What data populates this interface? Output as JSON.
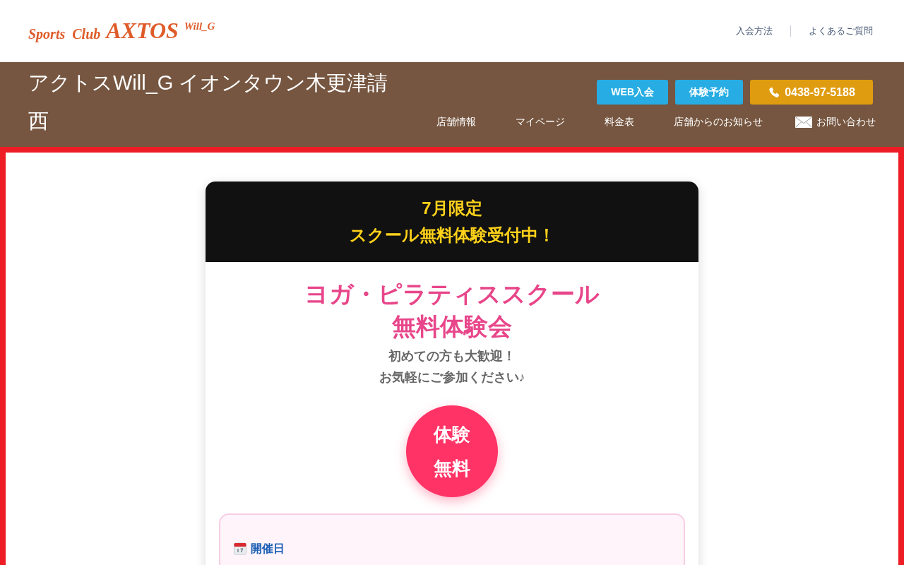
{
  "header": {
    "logo": {
      "prefix": "Sports  Club",
      "brand": "AXTOS",
      "suffix": "Will_G"
    },
    "links": [
      "入会方法",
      "よくあるご質問"
    ]
  },
  "store_bar": {
    "title": "アクトスWill_G イオンタウン木更津請西",
    "buttons": [
      {
        "label": "WEB入会",
        "kind": "primary"
      },
      {
        "label": "体験予約",
        "kind": "primary"
      },
      {
        "label": "0438-97-5188",
        "kind": "phone"
      }
    ],
    "nav": [
      {
        "label": "店舗情報",
        "kind": "text"
      },
      {
        "label": "マイページ",
        "kind": "text"
      },
      {
        "label": "料金表",
        "kind": "text"
      },
      {
        "label": "店舗からのお知らせ",
        "kind": "text"
      },
      {
        "label": "お問い合わせ",
        "kind": "mail"
      }
    ]
  },
  "promo": {
    "banner": [
      "7月限定",
      "スクール無料体験受付中！"
    ],
    "title": [
      "ヨガ・ピラティススクール",
      "無料体験会"
    ],
    "subtitle": [
      "初めての方も大歓迎！",
      "お気軽にご参加ください♪"
    ],
    "badge": [
      "体験",
      "無料"
    ],
    "info": {
      "heading": "開催日"
    }
  }
}
